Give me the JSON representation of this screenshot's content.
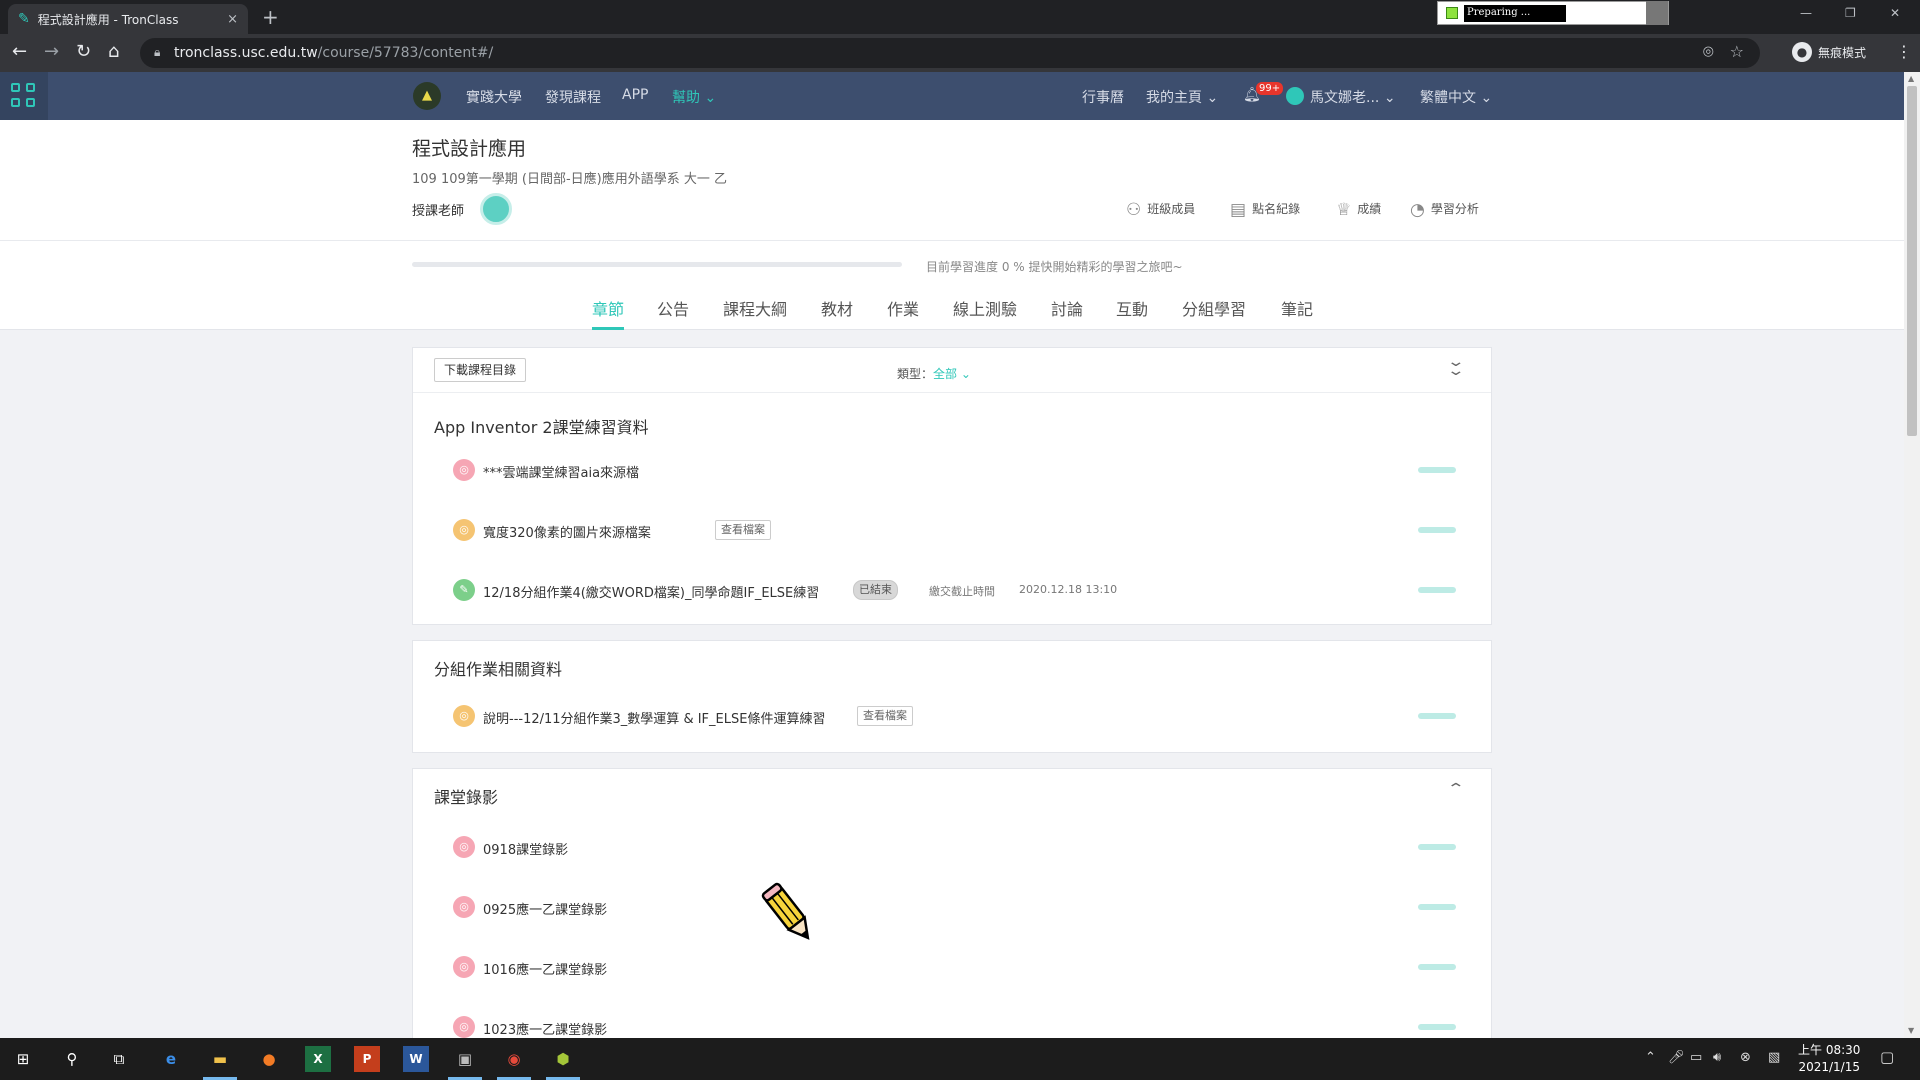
{
  "browser": {
    "tab_title": "程式設計應用 - TronClass",
    "tab_close": "×",
    "new_tab": "+",
    "preparing_text": "Preparing ...",
    "url_host": "tronclass.usc.edu.tw",
    "url_path": "/course/57783/content#/",
    "incognito_label": "無痕模式",
    "win_min": "—",
    "win_max": "❐",
    "win_close": "✕"
  },
  "header": {
    "nav": [
      "實踐大學",
      "發現課程",
      "APP",
      "幫助"
    ],
    "calendar": "行事曆",
    "my_home": "我的主頁",
    "notifications_badge": "99+",
    "user_name": "馬文娜老...",
    "language": "繁體中文"
  },
  "course": {
    "title": "程式設計應用",
    "subtitle": "109 109第一學期 (日間部-日應)應用外語學系 大一 乙",
    "teacher_label": "授課老師",
    "links": [
      "班級成員",
      "點名紀錄",
      "成績",
      "學習分析"
    ],
    "progress_percent": 0,
    "progress_text": "目前學習進度 0 % 提快開始精彩的學習之旅吧~",
    "tabs": [
      "章節",
      "公告",
      "課程大綱",
      "教材",
      "作業",
      "線上測驗",
      "討論",
      "互動",
      "分組學習",
      "筆記"
    ]
  },
  "content": {
    "download_label": "下載課程目錄",
    "type_label": "類型：",
    "type_value": "全部",
    "sections": [
      {
        "title": "App Inventor 2課堂練習資料",
        "items": [
          {
            "label": "***雲端課堂練習aia來源檔"
          },
          {
            "label": "寬度320像素的圖片來源檔案",
            "tag": "查看檔案"
          },
          {
            "label": "12/18分組作業4(繳交WORD檔案)_同學命題IF_ELSE練習",
            "tag": "已結束",
            "deadline_label": "繳交截止時間",
            "deadline": "2020.12.18 13:10"
          }
        ]
      },
      {
        "title": "分組作業相關資料",
        "items": [
          {
            "label": "說明---12/11分組作業3_數學運算 & IF_ELSE條件運算練習",
            "tag": "查看檔案"
          }
        ]
      },
      {
        "title": "課堂錄影",
        "items": [
          {
            "label": "0918課堂錄影"
          },
          {
            "label": "0925應一乙課堂錄影"
          },
          {
            "label": "1016應一乙課堂錄影"
          },
          {
            "label": "1023應一乙課堂錄影"
          }
        ]
      }
    ]
  },
  "taskbar": {
    "time": "上午 08:30",
    "date": "2021/1/15"
  },
  "colors": {
    "accent": "#2fc7b8",
    "header_bg": "#3d4e6e",
    "badge": "#e8352c"
  }
}
